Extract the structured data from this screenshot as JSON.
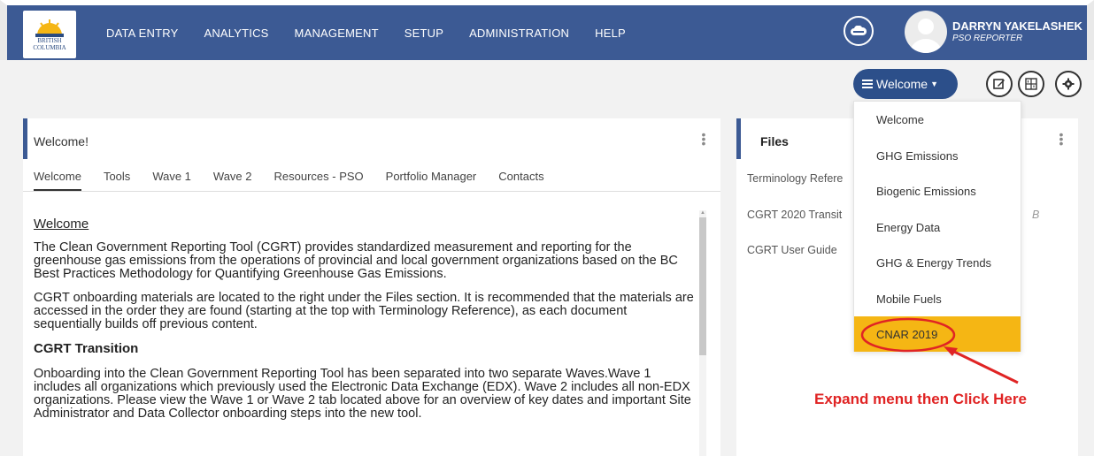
{
  "nav": {
    "logo_text_line1": "BRITISH",
    "logo_text_line2": "COLUMBIA",
    "items": [
      "DATA ENTRY",
      "ANALYTICS",
      "MANAGEMENT",
      "SETUP",
      "ADMINISTRATION",
      "HELP"
    ]
  },
  "user": {
    "name": "DARRYN YAKELASHEK",
    "role": "PSO REPORTER"
  },
  "toolbar": {
    "menu_label": "Welcome",
    "icons": [
      "edit-icon",
      "dashboard-icon",
      "gear-icon"
    ]
  },
  "welcome_panel": {
    "title": "Welcome!",
    "tabs": [
      "Welcome",
      "Tools",
      "Wave 1",
      "Wave 2",
      "Resources - PSO",
      "Portfolio Manager",
      "Contacts"
    ],
    "active_tab": "Welcome",
    "heading": "Welcome",
    "para1": "The Clean Government Reporting Tool (CGRT) provides standardized measurement and reporting for the greenhouse gas emissions from the operations of provincial and local government organizations based on the BC Best Practices Methodology for Quantifying Greenhouse Gas Emissions.",
    "para2": "CGRT onboarding materials are located to the right under the Files section. It is recommended that the materials are accessed in the order they are found (starting at the top with Terminology Reference), as each document sequentially builds off previous content.",
    "subheading": "CGRT Transition",
    "para3": "Onboarding into the Clean Government Reporting Tool has been separated into two separate Waves.Wave 1 includes all organizations which previously used the Electronic Data Exchange (EDX). Wave 2 includes all non-EDX organizations. Please view the Wave 1 or Wave 2 tab located above for an overview of key dates and important Site Administrator and Data Collector onboarding steps into the new tool."
  },
  "files_panel": {
    "title": "Files",
    "items": [
      "Terminology Refere",
      "CGRT 2020 Transit",
      "CGRT User Guide"
    ],
    "partial_suffix": "B"
  },
  "dropdown": {
    "items": [
      "Welcome",
      "GHG Emissions",
      "Biogenic Emissions",
      "Energy Data",
      "GHG & Energy Trends",
      "Mobile Fuels",
      "CNAR 2019"
    ],
    "highlighted": "CNAR 2019"
  },
  "annotation": {
    "text": "Expand menu then Click Here",
    "color": "#e02424"
  },
  "colors": {
    "nav_bg": "#3c5a94",
    "menu_button": "#2c4f8a",
    "highlight": "#f5b614"
  }
}
